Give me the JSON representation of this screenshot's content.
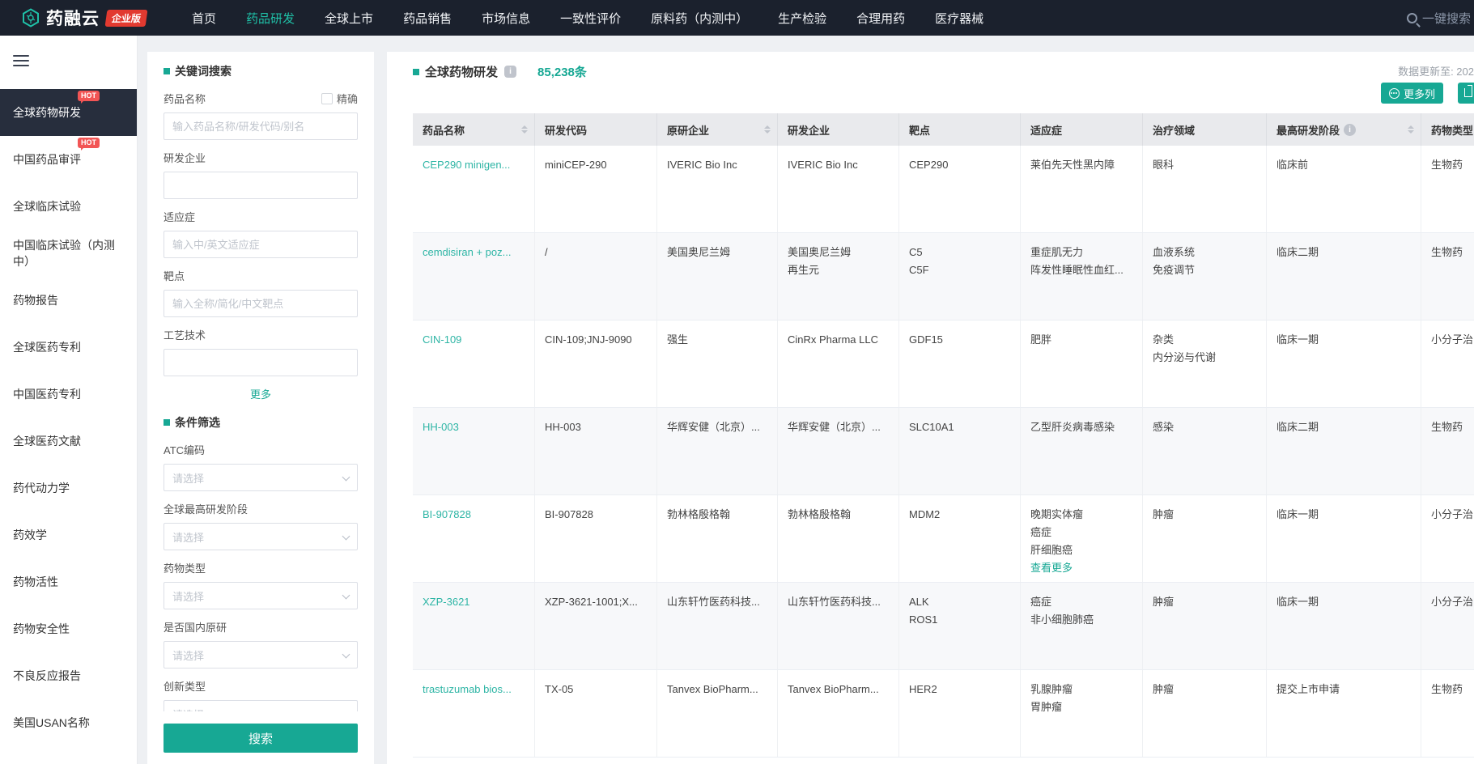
{
  "nav": {
    "logo_text": "药融云",
    "logo_badge": "企业版",
    "items": [
      {
        "label": "首页",
        "active": false
      },
      {
        "label": "药品研发",
        "active": true
      },
      {
        "label": "全球上市",
        "active": false
      },
      {
        "label": "药品销售",
        "active": false
      },
      {
        "label": "市场信息",
        "active": false
      },
      {
        "label": "一致性评价",
        "active": false
      },
      {
        "label": "原料药（内测中）",
        "active": false
      },
      {
        "label": "生产检验",
        "active": false
      },
      {
        "label": "合理用药",
        "active": false
      },
      {
        "label": "医疗器械",
        "active": false
      }
    ],
    "search_label": "一键搜索"
  },
  "sidebar": {
    "items": [
      {
        "label": "全球药物研发",
        "hot": true,
        "active": true
      },
      {
        "label": "中国药品审评",
        "hot": true,
        "active": false
      },
      {
        "label": "全球临床试验",
        "hot": false,
        "active": false
      },
      {
        "label": "中国临床试验（内测中）",
        "hot": false,
        "active": false
      },
      {
        "label": "药物报告",
        "hot": false,
        "active": false
      },
      {
        "label": "全球医药专利",
        "hot": false,
        "active": false
      },
      {
        "label": "中国医药专利",
        "hot": false,
        "active": false
      },
      {
        "label": "全球医药文献",
        "hot": false,
        "active": false
      },
      {
        "label": "药代动力学",
        "hot": false,
        "active": false
      },
      {
        "label": "药效学",
        "hot": false,
        "active": false
      },
      {
        "label": "药物活性",
        "hot": false,
        "active": false
      },
      {
        "label": "药物安全性",
        "hot": false,
        "active": false
      },
      {
        "label": "不良反应报告",
        "hot": false,
        "active": false
      },
      {
        "label": "美国USAN名称",
        "hot": false,
        "active": false
      }
    ]
  },
  "filter": {
    "keyword_title": "关键词搜索",
    "exact_label": "精确",
    "fields": [
      {
        "label": "药品名称",
        "placeholder": "输入药品名称/研发代码/别名",
        "value": "",
        "exact_option": true
      },
      {
        "label": "研发企业",
        "placeholder": "",
        "value": ""
      },
      {
        "label": "适应症",
        "placeholder": "输入中/英文适应症",
        "value": ""
      },
      {
        "label": "靶点",
        "placeholder": "输入全称/简化/中文靶点",
        "value": ""
      },
      {
        "label": "工艺技术",
        "placeholder": "",
        "value": ""
      }
    ],
    "more_label": "更多",
    "condition_title": "条件筛选",
    "selects": [
      {
        "label": "ATC编码",
        "placeholder": "请选择",
        "clipped": false
      },
      {
        "label": "全球最高研发阶段",
        "placeholder": "请选择",
        "clipped": false
      },
      {
        "label": "药物类型",
        "placeholder": "请选择",
        "clipped": false
      },
      {
        "label": "是否国内原研",
        "placeholder": "请选择",
        "clipped": false
      },
      {
        "label": "创新类型",
        "placeholder": "请选择",
        "clipped": true
      }
    ],
    "search_button": "搜索"
  },
  "main": {
    "title": "全球药物研发",
    "count": "85,238条",
    "updated": "数据更新至: 202",
    "more_columns": "更多列",
    "view_more": "查看更多",
    "columns": [
      {
        "label": "药品名称",
        "sortable": true,
        "info": false
      },
      {
        "label": "研发代码",
        "sortable": false,
        "info": false
      },
      {
        "label": "原研企业",
        "sortable": true,
        "info": false
      },
      {
        "label": "研发企业",
        "sortable": false,
        "info": false
      },
      {
        "label": "靶点",
        "sortable": false,
        "info": false
      },
      {
        "label": "适应症",
        "sortable": false,
        "info": false
      },
      {
        "label": "治疗领域",
        "sortable": false,
        "info": false
      },
      {
        "label": "最高研发阶段",
        "sortable": true,
        "info": true
      },
      {
        "label": "药物类型",
        "sortable": false,
        "info": false
      }
    ],
    "rows": [
      {
        "name": "CEP290 minigen...",
        "code": "miniCEP-290",
        "orig": [
          "IVERIC Bio Inc"
        ],
        "dev": [
          "IVERIC Bio Inc"
        ],
        "target": [
          "CEP290"
        ],
        "indication": [
          "莱伯先天性黑内障"
        ],
        "view_more": false,
        "area": [
          "眼科"
        ],
        "stage": "临床前",
        "type": "生物药"
      },
      {
        "name": "cemdisiran + poz...",
        "code": "/",
        "orig": [
          "美国奥尼兰姆"
        ],
        "dev": [
          "美国奥尼兰姆",
          "再生元"
        ],
        "target": [
          "C5",
          "C5F"
        ],
        "indication": [
          "重症肌无力",
          "阵发性睡眠性血红..."
        ],
        "view_more": false,
        "area": [
          "血液系统",
          "免疫调节"
        ],
        "stage": "临床二期",
        "type": "生物药"
      },
      {
        "name": "CIN-109",
        "code": "CIN-109;JNJ-9090",
        "orig": [
          "强生"
        ],
        "dev": [
          "CinRx Pharma LLC"
        ],
        "target": [
          "GDF15"
        ],
        "indication": [
          "肥胖"
        ],
        "view_more": false,
        "area": [
          "杂类",
          "内分泌与代谢"
        ],
        "stage": "临床一期",
        "type": "小分子治"
      },
      {
        "name": "HH-003",
        "code": "HH-003",
        "orig": [
          "华辉安健（北京）..."
        ],
        "dev": [
          "华辉安健（北京）..."
        ],
        "target": [
          "SLC10A1"
        ],
        "indication": [
          "乙型肝炎病毒感染"
        ],
        "view_more": false,
        "area": [
          "感染"
        ],
        "stage": "临床二期",
        "type": "生物药"
      },
      {
        "name": "BI-907828",
        "code": "BI-907828",
        "orig": [
          "勃林格殷格翰"
        ],
        "dev": [
          "勃林格殷格翰"
        ],
        "target": [
          "MDM2"
        ],
        "indication": [
          "晚期实体瘤",
          "癌症",
          "肝细胞癌"
        ],
        "view_more": true,
        "area": [
          "肿瘤"
        ],
        "stage": "临床一期",
        "type": "小分子治"
      },
      {
        "name": "XZP-3621",
        "code": "XZP-3621-1001;X...",
        "orig": [
          "山东轩竹医药科技..."
        ],
        "dev": [
          "山东轩竹医药科技..."
        ],
        "target": [
          "ALK",
          "ROS1"
        ],
        "indication": [
          "癌症",
          "非小细胞肺癌"
        ],
        "view_more": false,
        "area": [
          "肿瘤"
        ],
        "stage": "临床一期",
        "type": "小分子治"
      },
      {
        "name": "trastuzumab bios...",
        "code": "TX-05",
        "orig": [
          "Tanvex BioPharm..."
        ],
        "dev": [
          "Tanvex BioPharm..."
        ],
        "target": [
          "HER2"
        ],
        "indication": [
          "乳腺肿瘤",
          "胃肿瘤"
        ],
        "view_more": false,
        "area": [
          "肿瘤"
        ],
        "stage": "提交上市申请",
        "type": "生物药"
      }
    ]
  },
  "colors": {
    "accent_teal": "#17a894",
    "link_teal": "#2eb5a5",
    "nav_bg": "#1b212d",
    "hot_red": "#f25555",
    "badge_red": "#e23a30",
    "table_header_bg": "#e9eaed"
  }
}
